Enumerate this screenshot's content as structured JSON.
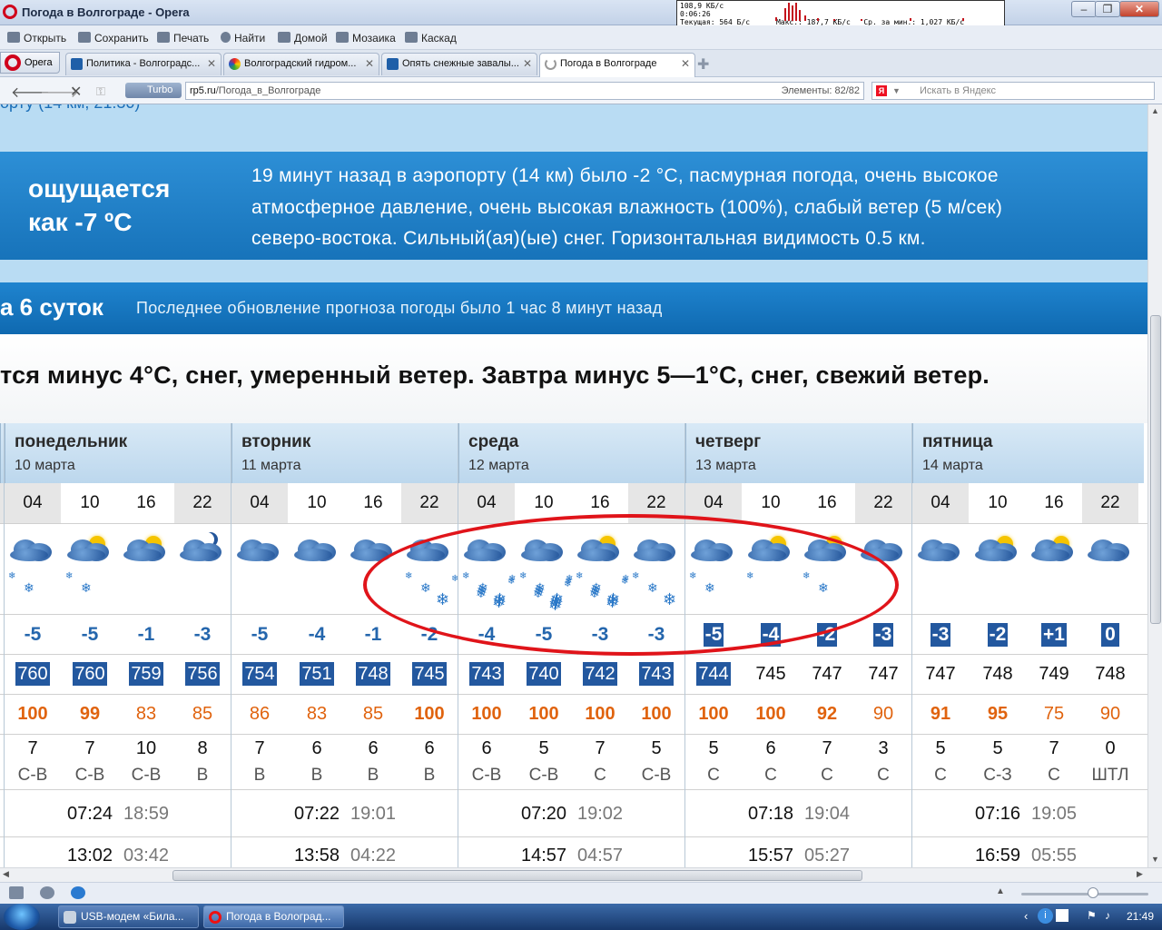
{
  "window": {
    "title": "Погода в Волгограде - Opera",
    "netmon": {
      "line1": "108,9 КБ/с",
      "line2": "0:06:26",
      "current": "Текущая: 564 Б/с",
      "max": "Макс.: 187,7 КБ/с",
      "avg": "Ср. за мин.: 1,027 КБ/с"
    }
  },
  "toolbar": {
    "open": "Открыть",
    "save": "Сохранить",
    "print": "Печать",
    "find": "Найти",
    "home": "Домой",
    "mosaic": "Мозаика",
    "cascade": "Каскад"
  },
  "tabs": {
    "menu": "Opera",
    "items": [
      {
        "label": "Политика - Волгоградс..."
      },
      {
        "label": "Волгоградский гидром..."
      },
      {
        "label": "Опять снежные завалы..."
      },
      {
        "label": "Погода в Волгограде"
      }
    ]
  },
  "address": {
    "turbo": "Turbo",
    "host": "rp5.ru",
    "path": "/Погода_в_Волгограде",
    "elements": "Элементы:   82/82",
    "search_placeholder": "Искать в Яндекс"
  },
  "page": {
    "cut_line": "орту (14 км, 21:30)",
    "feels_label": "ощущается\nкак -7 ºC",
    "feels_text": "19 минут назад в аэропорту (14 км) было -2 °С, пасмурная погода, очень высокое\nатмосферное давление, очень высокая влажность (100%), слабый ветер (5 м/сек)\nсеверо-востока. Сильный(ая)(ые) снег. Горизонтальная видимость 0.5 км.",
    "six_days": "а 6 суток",
    "update": "Последнее обновление прогноза погоды было 1 час 8 минут назад",
    "summary": "тся минус 4°С, снег, умеренный ветер. Завтра минус 5—1°С, снег, свежий ветер."
  },
  "forecast": {
    "days": [
      {
        "name": "понедельник",
        "date": "10 марта"
      },
      {
        "name": "вторник",
        "date": "11 марта"
      },
      {
        "name": "среда",
        "date": "12 марта"
      },
      {
        "name": "четверг",
        "date": "13 марта"
      },
      {
        "name": "пятница",
        "date": "14 марта"
      }
    ],
    "hours": [
      "04",
      "10",
      "16",
      "22",
      "04",
      "10",
      "16",
      "22",
      "04",
      "10",
      "16",
      "22",
      "04",
      "10",
      "16",
      "22",
      "04",
      "10",
      "16",
      "22"
    ],
    "icons": [
      "cloud-night",
      "cloud-sun",
      "cloud-sun",
      "moon-cloud",
      "cloud-night",
      "cloud",
      "cloud",
      "cloud-night",
      "cloud-night",
      "cloud",
      "cloud-sun",
      "cloud-night",
      "cloud-night",
      "cloud-sun",
      "cloud-sun",
      "cloud-night",
      "cloud-night",
      "cloud-sun",
      "cloud-sun",
      "cloud-night"
    ],
    "snow": [
      2,
      2,
      0,
      0,
      0,
      0,
      0,
      4,
      8,
      10,
      8,
      3,
      2,
      1,
      2,
      0,
      0,
      0,
      0,
      0
    ],
    "temps": [
      "-5",
      "-5",
      "-1",
      "-3",
      "-5",
      "-4",
      "-1",
      "-2",
      "-4",
      "-5",
      "-3",
      "-3",
      "-5",
      "-4",
      "-2",
      "-3",
      "-3",
      "-2",
      "+1",
      "0"
    ],
    "temps_inv": [
      false,
      false,
      false,
      false,
      false,
      false,
      false,
      false,
      false,
      false,
      false,
      false,
      true,
      true,
      true,
      true,
      true,
      true,
      true,
      true
    ],
    "pressure": [
      "760",
      "760",
      "759",
      "756",
      "754",
      "751",
      "748",
      "745",
      "743",
      "740",
      "742",
      "743",
      "744",
      "745",
      "747",
      "747",
      "747",
      "748",
      "749",
      "748"
    ],
    "pressure_inv": [
      true,
      true,
      true,
      true,
      true,
      true,
      true,
      true,
      true,
      true,
      true,
      true,
      true,
      false,
      false,
      false,
      false,
      false,
      false,
      false
    ],
    "humidity": [
      "100",
      "99",
      "83",
      "85",
      "86",
      "83",
      "85",
      "100",
      "100",
      "100",
      "100",
      "100",
      "100",
      "100",
      "92",
      "90",
      "91",
      "95",
      "75",
      "90"
    ],
    "humidity_colors": [
      "#e0630e",
      "#e0630e",
      "#e0630e",
      "#e0630e",
      "#e0630e",
      "#e0630e",
      "#e0630e",
      "#e0630e",
      "#e0630e",
      "#e0630e",
      "#e0630e",
      "#e0630e",
      "#e0630e",
      "#e0630e",
      "#e0630e",
      "#e0630e",
      "#e0630e",
      "#e0630e",
      "#e0630e",
      "#e0630e"
    ],
    "humidity_bold": [
      true,
      true,
      false,
      false,
      false,
      false,
      false,
      true,
      true,
      true,
      true,
      true,
      true,
      true,
      true,
      false,
      true,
      true,
      false,
      false
    ],
    "wind_speed": [
      "7",
      "7",
      "10",
      "8",
      "7",
      "6",
      "6",
      "6",
      "6",
      "5",
      "7",
      "5",
      "5",
      "6",
      "7",
      "3",
      "5",
      "5",
      "7",
      "0"
    ],
    "wind_dir": [
      "С-В",
      "С-В",
      "С-В",
      "В",
      "В",
      "В",
      "В",
      "В",
      "С-В",
      "С-В",
      "С",
      "С-В",
      "С",
      "С",
      "С",
      "С",
      "С",
      "С-З",
      "С",
      "ШТЛ"
    ],
    "sunrise": [
      "07:24",
      "07:22",
      "07:20",
      "07:18",
      "07:16"
    ],
    "sunset": [
      "18:59",
      "19:01",
      "19:02",
      "19:04",
      "19:05"
    ],
    "daylength": [
      "13:02",
      "13:58",
      "14:57",
      "15:57",
      "16:59"
    ],
    "moon": [
      "03:42",
      "04:22",
      "04:57",
      "05:27",
      "05:55"
    ]
  },
  "statusbar": {},
  "taskbar": {
    "items": [
      {
        "label": "USB-модем «Била..."
      },
      {
        "label": "Погода в Волоград..."
      }
    ],
    "clock": "21:49"
  },
  "colors": {
    "header_blue": "#1773ba",
    "light_band": "#b9dcf3",
    "highlight_box": "#23589f",
    "humidity_orange": "#e0630e",
    "annotation_red": "#e0141a"
  }
}
